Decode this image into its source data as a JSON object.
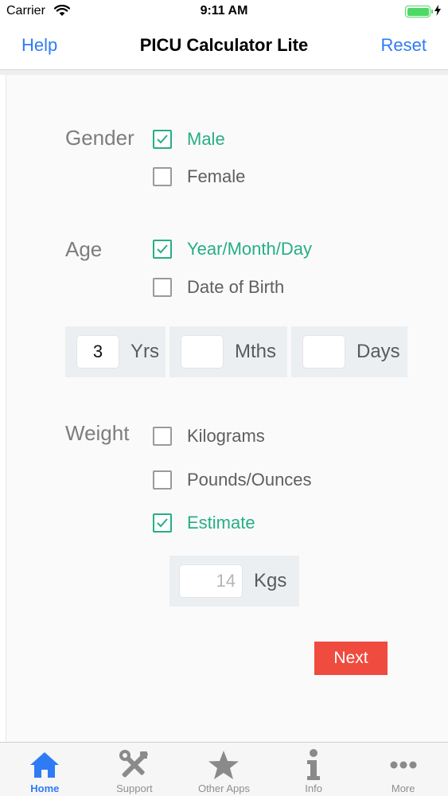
{
  "status_bar": {
    "carrier": "Carrier",
    "time": "9:11 AM",
    "battery_level": 1.0
  },
  "nav": {
    "left_button": "Help",
    "title": "PICU Calculator Lite",
    "right_button": "Reset"
  },
  "gender": {
    "label": "Gender",
    "options": [
      {
        "label": "Male",
        "checked": true
      },
      {
        "label": "Female",
        "checked": false
      }
    ]
  },
  "age": {
    "label": "Age",
    "options": [
      {
        "label": "Year/Month/Day",
        "checked": true
      },
      {
        "label": "Date of Birth",
        "checked": false
      }
    ],
    "fields": [
      {
        "value": "3",
        "unit": "Yrs"
      },
      {
        "value": "",
        "unit": "Mths"
      },
      {
        "value": "",
        "unit": "Days"
      }
    ]
  },
  "weight": {
    "label": "Weight",
    "options": [
      {
        "label": "Kilograms",
        "checked": false
      },
      {
        "label": "Pounds/Ounces",
        "checked": false
      },
      {
        "label": "Estimate",
        "checked": true
      }
    ],
    "estimate": {
      "placeholder": "14",
      "unit": "Kgs"
    }
  },
  "next_button": "Next",
  "tabs": [
    {
      "label": "Home",
      "icon": "home-icon",
      "active": true
    },
    {
      "label": "Support",
      "icon": "tools-icon",
      "active": false
    },
    {
      "label": "Other Apps",
      "icon": "star-icon",
      "active": false
    },
    {
      "label": "Info",
      "icon": "info-icon",
      "active": false
    },
    {
      "label": "More",
      "icon": "more-icon",
      "active": false
    }
  ],
  "colors": {
    "accent": "#27ae85",
    "link": "#2f7bf6",
    "next": "#ef4b3e",
    "battery": "#4cd964"
  }
}
